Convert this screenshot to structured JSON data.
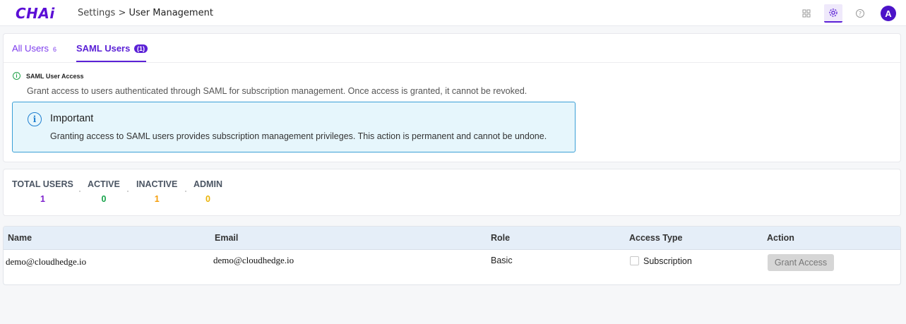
{
  "app": {
    "logo_text": "CHAi",
    "breadcrumb_parent": "Settings",
    "breadcrumb_sep": ">",
    "breadcrumb_current": "User Management",
    "avatar_letter": "A"
  },
  "tabs": {
    "all_label": "All Users",
    "all_count": "6",
    "saml_label": "SAML Users",
    "saml_count": "(1)"
  },
  "info": {
    "title": "SAML User Access",
    "description": "Grant access to users authenticated through SAML for subscription management. Once access is granted, it cannot be revoked.",
    "important_title": "Important",
    "important_text": "Granting access to SAML users provides subscription management privileges. This action is permanent and cannot be undone."
  },
  "stats": [
    {
      "label": "TOTAL USERS",
      "value": "1",
      "color": "#7e22ce"
    },
    {
      "label": "ACTIVE",
      "value": "0",
      "color": "#16a34a"
    },
    {
      "label": "INACTIVE",
      "value": "1",
      "color": "#f59e0b"
    },
    {
      "label": "ADMIN",
      "value": "0",
      "color": "#eab308"
    }
  ],
  "table": {
    "headers": [
      "Name",
      "Email",
      "Role",
      "Access Type",
      "Action"
    ],
    "rows": [
      {
        "name": "demo@cloudhedge.io",
        "email": "demo@cloudhedge.io",
        "role": "Basic",
        "access_type": "Subscription",
        "action": "Grant Access"
      }
    ]
  },
  "colors": {
    "brand": "#5b21d6",
    "info_bg": "#e6f6fc",
    "info_border": "#3a9fd6",
    "table_header_bg": "#e5eef8"
  }
}
